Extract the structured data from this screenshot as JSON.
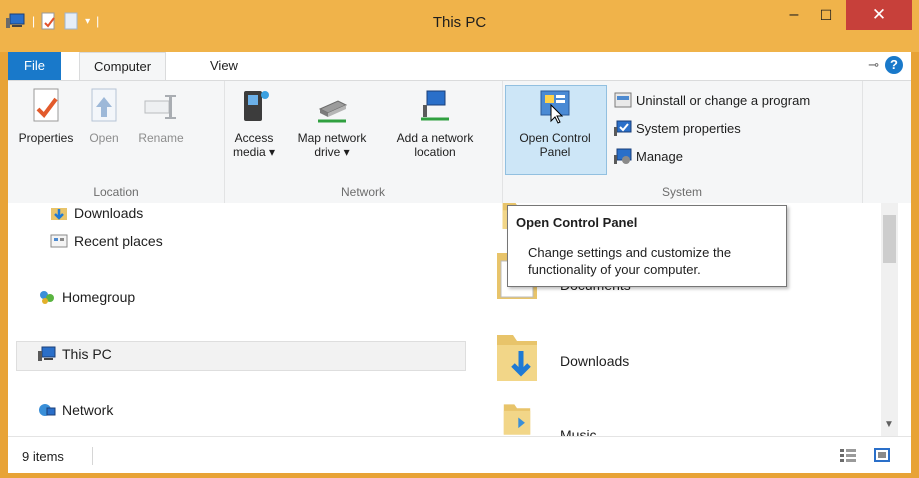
{
  "window": {
    "title": "This PC",
    "close_glyph": "✕",
    "minimize_glyph": "–",
    "maximize_glyph": "☐"
  },
  "ribbon_tabs": {
    "file": "File",
    "computer": "Computer",
    "view": "View"
  },
  "groups": {
    "location": {
      "label": "Location",
      "properties": "Properties",
      "open": "Open",
      "rename": "Rename"
    },
    "network": {
      "label": "Network",
      "access_media_line1": "Access",
      "access_media_line2": "media ▾",
      "map_drive_line1": "Map network",
      "map_drive_line2": "drive ▾",
      "add_location_line1": "Add a network",
      "add_location_line2": "location"
    },
    "system": {
      "label": "System",
      "open_cp_line1": "Open Control",
      "open_cp_line2": "Panel",
      "uninstall": "Uninstall or change a program",
      "system_properties": "System properties",
      "manage": "Manage"
    }
  },
  "navigation": {
    "downloads": "Downloads",
    "recent_places": "Recent places",
    "homegroup": "Homegroup",
    "this_pc": "This PC",
    "network": "Network"
  },
  "folders": {
    "documents": "Documents",
    "downloads": "Downloads",
    "music": "Music"
  },
  "tooltip": {
    "title": "Open Control Panel",
    "description": "Change settings and customize the functionality of your computer."
  },
  "status": {
    "item_count": "9 items"
  },
  "colors": {
    "titlebar": "#f0b34a",
    "file_tab": "#1979ca",
    "close_button": "#c7403a",
    "selection": "#cde6f7"
  }
}
